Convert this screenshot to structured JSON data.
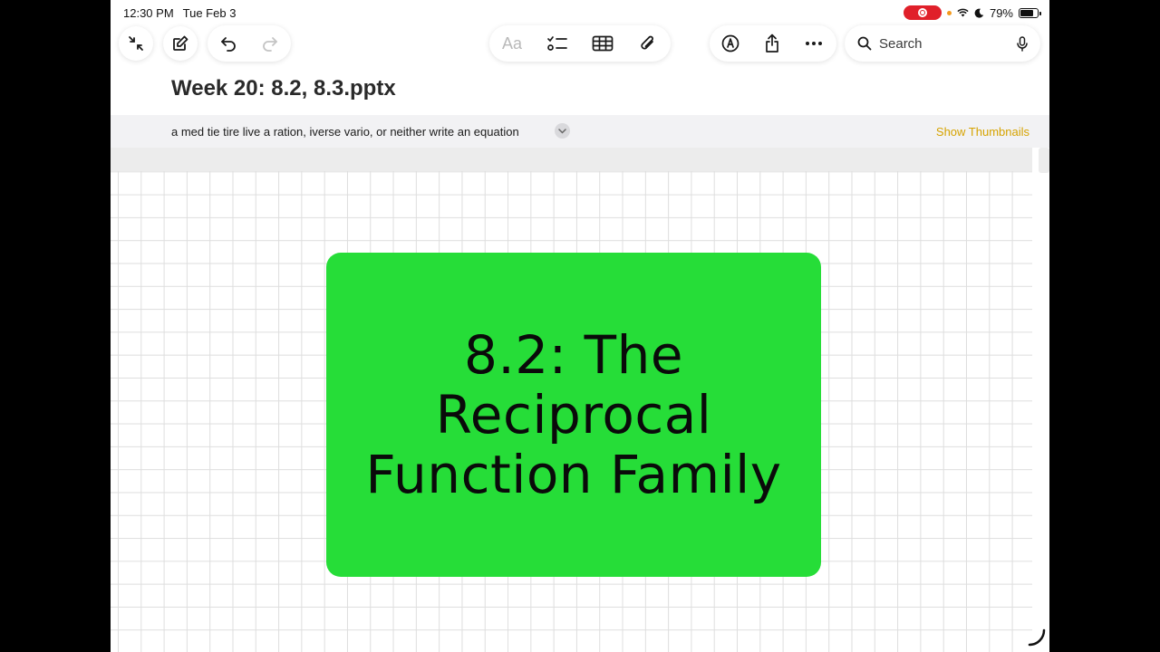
{
  "status_bar": {
    "time": "12:30 PM",
    "date": "Tue Feb 3",
    "battery_percent": "79%",
    "battery_level": 0.79,
    "recording_color": "#e0202a"
  },
  "toolbar": {
    "left_icons": [
      "collapse-icon",
      "compose-icon",
      "undo-icon",
      "redo-icon"
    ],
    "format_label": "Aa",
    "center_icons": [
      "checklist-icon",
      "table-icon",
      "attachment-icon"
    ],
    "right_icons": [
      "markup-icon",
      "share-icon",
      "more-icon"
    ],
    "search_placeholder": "Search"
  },
  "note": {
    "title": "Week 20: 8.2, 8.3.pptx",
    "attachment_name": "a med tie tire live a ration, iverse vario, or neither write an equation",
    "show_thumbnails_label": "Show Thumbnails",
    "accent_color": "#d6a300"
  },
  "slide": {
    "line1": "8.2: The",
    "line2": "Reciprocal",
    "line3": "Function Family",
    "background_color": "#26dd38"
  }
}
